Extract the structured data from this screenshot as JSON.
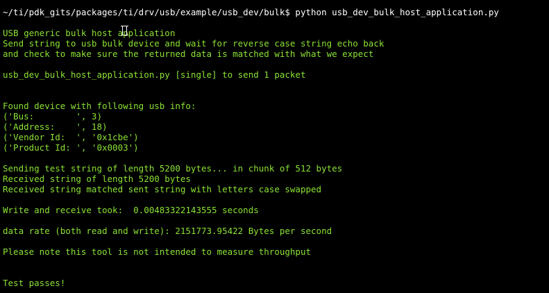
{
  "terminal": {
    "prompt_line": "~/ti/pdk_gits/packages/ti/drv/usb/example/usb_dev/bulk$ python usb_dev_bulk_host_application.py",
    "colors": {
      "background": "#000000",
      "prompt": "#ffffff",
      "output": "#8ae234"
    },
    "output": {
      "intro_1": "USB generic bulk host application",
      "intro_2": "Send string to usb bulk device and wait for reverse case string echo back",
      "intro_3": "and check to make sure the returned data is matched with what we expect",
      "usage": "usb_dev_bulk_host_application.py [single] to send 1 packet",
      "found": "Found device with following usb info:",
      "bus": "('Bus:        ', 3)",
      "address": "('Address:    ', 18)",
      "vendor": "('Vendor Id:  ', '0x1cbe')",
      "product": "('Product Id: ', '0x0003')",
      "sending": "Sending test string of length 5200 bytes... in chunk of 512 bytes",
      "received": "Received string of length 5200 bytes",
      "matched": "Received string matched sent string with letters case swapped",
      "took": "Write and receive took:  0.00483322143555 seconds",
      "rate": "data rate (both read and write): 2151773.95422 Bytes per second",
      "note": "Please note this tool is not intended to measure throughput",
      "passes": "Test passes!"
    }
  }
}
